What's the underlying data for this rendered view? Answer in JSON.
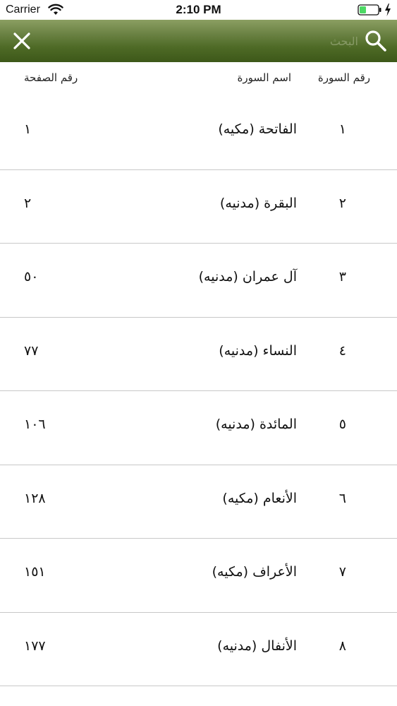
{
  "status_bar": {
    "carrier": "Carrier",
    "time": "2:10 PM"
  },
  "navbar": {
    "search_placeholder": "البحث",
    "search_value": "",
    "close_icon": "close-icon",
    "search_icon": "search-icon",
    "bar_color": "#4e6a26"
  },
  "table": {
    "headers": {
      "surah_number": "رقم السورة",
      "surah_name": "اسم السورة",
      "page_number": "رقم الصفحة"
    },
    "rows": [
      {
        "number": "١",
        "name": "الفاتحة (مكيه)",
        "page": "١"
      },
      {
        "number": "٢",
        "name": "البقرة (مدنيه)",
        "page": "٢"
      },
      {
        "number": "٣",
        "name": "آل عمران (مدنيه)",
        "page": "٥٠"
      },
      {
        "number": "٤",
        "name": "النساء (مدنيه)",
        "page": "٧٧"
      },
      {
        "number": "٥",
        "name": "المائدة (مدنيه)",
        "page": "١٠٦"
      },
      {
        "number": "٦",
        "name": "الأنعام (مكيه)",
        "page": "١٢٨"
      },
      {
        "number": "٧",
        "name": "الأعراف (مكيه)",
        "page": "١٥١"
      },
      {
        "number": "٨",
        "name": "الأنفال (مدنيه)",
        "page": "١٧٧"
      }
    ]
  }
}
